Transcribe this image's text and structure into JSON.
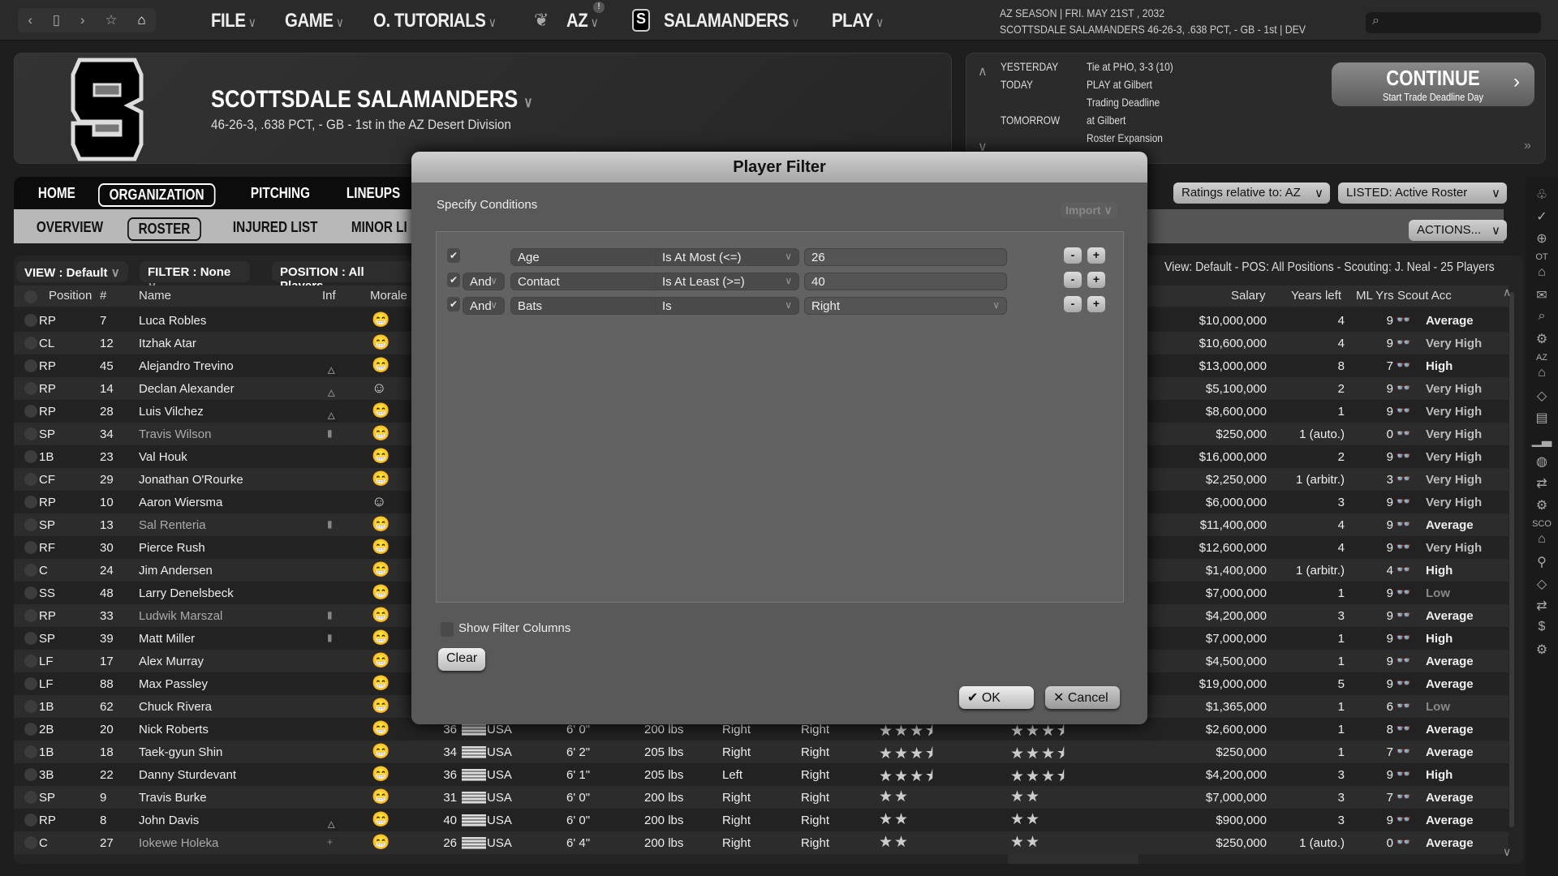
{
  "topbar": {
    "nav_icons": [
      "back-icon",
      "page-icon",
      "forward-icon",
      "star-icon",
      "home-icon"
    ],
    "menus": [
      {
        "label": "FILE"
      },
      {
        "label": "GAME"
      },
      {
        "label": "O. TUTORIALS"
      },
      {
        "label": "AZ",
        "badge": "!"
      },
      {
        "label": "SALAMANDERS"
      },
      {
        "label": "PLAY"
      }
    ],
    "season_line": "AZ SEASON  |  FRI. MAY 21ST , 2032",
    "team_line": "SCOTTSDALE SALAMANDERS   46-26-3, .638 PCT, - GB - 1st | DEV",
    "search_placeholder": ""
  },
  "header": {
    "team_name": "SCOTTSDALE SALAMANDERS",
    "record": "46-26-3, .638 PCT, - GB - 1st in the AZ Desert Division",
    "logo_letter": "S"
  },
  "schedule": {
    "yesterday_label": "YESTERDAY",
    "yesterday": "Tie at PHO, 3-3 (10)",
    "today_label": "TODAY",
    "today": "PLAY at Gilbert",
    "today2": "Trading Deadline",
    "tomorrow_label": "TOMORROW",
    "tomorrow": "at Gilbert",
    "tomorrow2": "Roster Expansion",
    "continue_label": "CONTINUE",
    "continue_sub": "Start Trade Deadline Day"
  },
  "nav": {
    "main": [
      "HOME",
      "ORGANIZATION",
      "PITCHING",
      "LINEUPS"
    ],
    "main_active": "ORGANIZATION",
    "sub": [
      "OVERVIEW",
      "ROSTER",
      "INJURED LIST",
      "MINOR LI"
    ],
    "sub_active": "ROSTER"
  },
  "controls": {
    "ratings": "Ratings relative to: AZ",
    "listed": "LISTED: Active Roster",
    "actions": "ACTIONS..."
  },
  "toolbar": {
    "view": "VIEW : Default",
    "filter": "FILTER : None",
    "position": "POSITION : All Players",
    "view_info": "View: Default - POS: All Positions - Scouting: J. Neal - 25 Players"
  },
  "columns": {
    "position": "Position",
    "num": "#",
    "name": "Name",
    "inf": "Inf",
    "morale": "Morale",
    "salary": "Salary",
    "years_left": "Years left",
    "ml_yrs": "ML Yrs",
    "scout_acc": "Scout Acc"
  },
  "rows": [
    {
      "pos": "RP",
      "num": "7",
      "name": "Luca Robles",
      "inf": "",
      "morale": "grin",
      "salary": "$10,000,000",
      "yl": "4",
      "ml": "9",
      "acc": "Average"
    },
    {
      "pos": "CL",
      "num": "12",
      "name": "Itzhak Atar",
      "inf": "",
      "morale": "grin",
      "salary": "$10,600,000",
      "yl": "4",
      "ml": "9",
      "acc": "Very High"
    },
    {
      "pos": "RP",
      "num": "45",
      "name": "Alejandro Trevino",
      "inf": "flame",
      "morale": "grin",
      "salary": "$13,000,000",
      "yl": "8",
      "ml": "7",
      "acc": "High"
    },
    {
      "pos": "RP",
      "num": "14",
      "name": "Declan Alexander",
      "inf": "flame",
      "morale": "smile",
      "salary": "$5,100,000",
      "yl": "2",
      "ml": "9",
      "acc": "Very High"
    },
    {
      "pos": "RP",
      "num": "28",
      "name": "Luis Vilchez",
      "inf": "flame",
      "morale": "grin",
      "salary": "$8,600,000",
      "yl": "1",
      "ml": "9",
      "acc": "Very High"
    },
    {
      "pos": "SP",
      "num": "34",
      "name": "Travis Wilson",
      "inf": "bar",
      "dim": true,
      "morale": "grin",
      "salary": "$250,000",
      "yl": "1 (auto.)",
      "ml": "0",
      "acc": "Very High"
    },
    {
      "pos": "1B",
      "num": "23",
      "name": "Val Houk",
      "inf": "",
      "morale": "grin",
      "salary": "$16,000,000",
      "yl": "2",
      "ml": "9",
      "acc": "Very High"
    },
    {
      "pos": "CF",
      "num": "29",
      "name": "Jonathan O'Rourke",
      "inf": "",
      "morale": "grin",
      "salary": "$2,250,000",
      "yl": "1 (arbitr.)",
      "ml": "3",
      "acc": "Very High"
    },
    {
      "pos": "RP",
      "num": "10",
      "name": "Aaron Wiersma",
      "inf": "",
      "morale": "smile",
      "salary": "$6,000,000",
      "yl": "3",
      "ml": "9",
      "acc": "Very High"
    },
    {
      "pos": "SP",
      "num": "13",
      "name": "Sal Renteria",
      "inf": "bar",
      "dim": true,
      "morale": "grin",
      "salary": "$11,400,000",
      "yl": "4",
      "ml": "9",
      "acc": "Average"
    },
    {
      "pos": "RF",
      "num": "30",
      "name": "Pierce Rush",
      "inf": "",
      "morale": "grin",
      "salary": "$12,600,000",
      "yl": "4",
      "ml": "9",
      "acc": "Very High"
    },
    {
      "pos": "C",
      "num": "24",
      "name": "Jim Andersen",
      "inf": "",
      "morale": "grin",
      "salary": "$1,400,000",
      "yl": "1 (arbitr.)",
      "ml": "4",
      "acc": "High"
    },
    {
      "pos": "SS",
      "num": "48",
      "name": "Larry Denelsbeck",
      "inf": "",
      "morale": "grin",
      "salary": "$7,000,000",
      "yl": "1",
      "ml": "9",
      "acc": "Low"
    },
    {
      "pos": "RP",
      "num": "33",
      "name": "Ludwik Marszal",
      "inf": "bar",
      "dim": true,
      "morale": "grin",
      "salary": "$4,200,000",
      "yl": "3",
      "ml": "9",
      "acc": "Average"
    },
    {
      "pos": "SP",
      "num": "39",
      "name": "Matt Miller",
      "inf": "bar",
      "morale": "grin",
      "salary": "$7,000,000",
      "yl": "1",
      "ml": "9",
      "acc": "High"
    },
    {
      "pos": "LF",
      "num": "17",
      "name": "Alex Murray",
      "inf": "",
      "morale": "grin",
      "salary": "$4,500,000",
      "yl": "1",
      "ml": "9",
      "acc": "Average"
    },
    {
      "pos": "LF",
      "num": "88",
      "name": "Max Passley",
      "inf": "",
      "morale": "grin",
      "salary": "$19,000,000",
      "yl": "5",
      "ml": "9",
      "acc": "Average"
    },
    {
      "pos": "1B",
      "num": "62",
      "name": "Chuck Rivera",
      "inf": "",
      "morale": "grin",
      "salary": "$1,365,000",
      "yl": "1",
      "ml": "6",
      "acc": "Low"
    },
    {
      "pos": "2B",
      "num": "20",
      "name": "Nick Roberts",
      "inf": "",
      "morale": "grin",
      "age": "36",
      "nat": "USA",
      "ht": "6' 0\"",
      "wt": "200 lbs",
      "bats": "Right",
      "throws": "Right",
      "cur": 3.5,
      "pot": 3.5,
      "salary": "$2,600,000",
      "yl": "1",
      "ml": "8",
      "acc": "Average"
    },
    {
      "pos": "1B",
      "num": "18",
      "name": "Taek-gyun Shin",
      "inf": "",
      "morale": "grin",
      "age": "34",
      "nat": "USA",
      "ht": "6' 2\"",
      "wt": "205 lbs",
      "bats": "Right",
      "throws": "Right",
      "cur": 3.5,
      "pot": 3.5,
      "salary": "$250,000",
      "yl": "1",
      "ml": "7",
      "acc": "Average"
    },
    {
      "pos": "3B",
      "num": "22",
      "name": "Danny Sturdevant",
      "inf": "",
      "morale": "grin",
      "age": "36",
      "nat": "USA",
      "ht": "6' 1\"",
      "wt": "205 lbs",
      "bats": "Left",
      "throws": "Right",
      "cur": 3.5,
      "pot": 3.5,
      "salary": "$4,200,000",
      "yl": "3",
      "ml": "9",
      "acc": "High"
    },
    {
      "pos": "SP",
      "num": "9",
      "name": "Travis Burke",
      "inf": "",
      "morale": "grin",
      "age": "31",
      "nat": "USA",
      "ht": "6' 0\"",
      "wt": "200 lbs",
      "bats": "Right",
      "throws": "Right",
      "cur": 2,
      "pot": 2,
      "salary": "$7,000,000",
      "yl": "3",
      "ml": "7",
      "acc": "Average"
    },
    {
      "pos": "RP",
      "num": "8",
      "name": "John Davis",
      "inf": "flame",
      "morale": "grin",
      "age": "40",
      "nat": "USA",
      "ht": "6' 0\"",
      "wt": "200 lbs",
      "bats": "Right",
      "throws": "Right",
      "cur": 2,
      "pot": 2,
      "salary": "$900,000",
      "yl": "3",
      "ml": "9",
      "acc": "Average"
    },
    {
      "pos": "C",
      "num": "27",
      "name": "Iokewe Holeka",
      "inf": "plus",
      "dim": true,
      "morale": "grin",
      "age": "26",
      "nat": "USA",
      "ht": "6' 4\"",
      "wt": "200 lbs",
      "bats": "Right",
      "throws": "Right",
      "cur": 2,
      "pot": 2,
      "salary": "$250,000",
      "yl": "1 (auto.)",
      "ml": "0",
      "acc": "Average"
    }
  ],
  "sidebar": {
    "sections": [
      "OT",
      "AZ",
      "SCO"
    ]
  },
  "dialog": {
    "title": "Player Filter",
    "subtitle": "Specify Conditions",
    "import_label": "Import",
    "conditions": [
      {
        "checked": true,
        "join": "",
        "field": "Age",
        "op": "Is At Most (<=)",
        "value": "26"
      },
      {
        "checked": true,
        "join": "And",
        "field": "Contact",
        "op": "Is At Least (>=)",
        "value": "40"
      },
      {
        "checked": true,
        "join": "And",
        "field": "Bats",
        "op": "Is",
        "value": "Right",
        "value_is_select": true
      }
    ],
    "show_filter_columns": "Show Filter Columns",
    "show_filter_checked": false,
    "clear": "Clear",
    "ok": "OK",
    "cancel": "Cancel"
  }
}
